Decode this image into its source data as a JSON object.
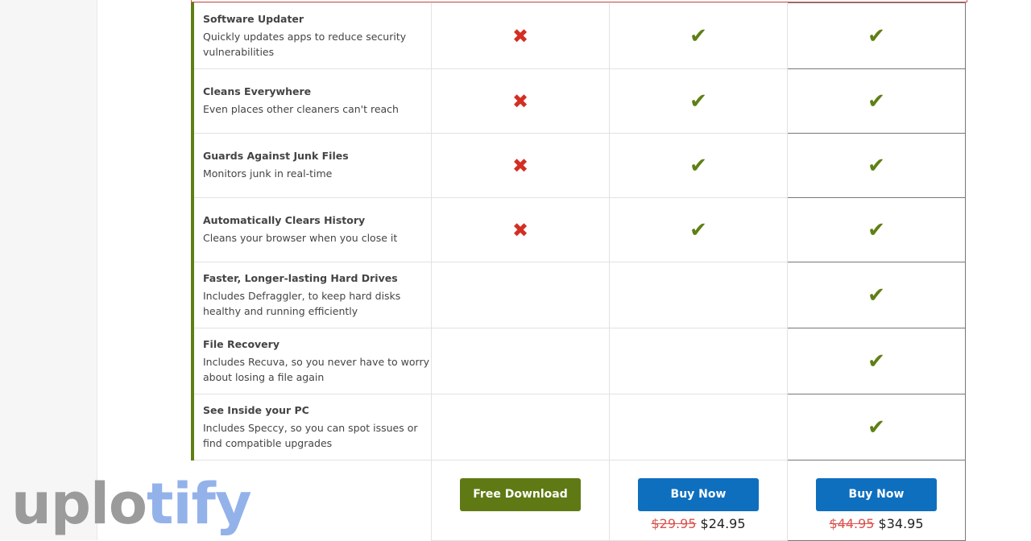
{
  "features": [
    {
      "title": "Software Updater",
      "desc": "Quickly updates apps to reduce security vulnerabilities",
      "plans": [
        false,
        true,
        true
      ]
    },
    {
      "title": "Cleans Everywhere",
      "desc": "Even places other cleaners can't reach",
      "plans": [
        false,
        true,
        true
      ]
    },
    {
      "title": "Guards Against Junk Files",
      "desc": "Monitors junk in real-time",
      "plans": [
        false,
        true,
        true
      ]
    },
    {
      "title": "Automatically Clears History",
      "desc": "Cleans your browser when you close it",
      "plans": [
        false,
        true,
        true
      ]
    },
    {
      "title": "Faster, Longer-lasting Hard Drives",
      "desc": "Includes Defraggler, to keep hard disks healthy and running efficiently",
      "plans": [
        null,
        null,
        true
      ]
    },
    {
      "title": "File Recovery",
      "desc": "Includes Recuva, so you never have to worry about losing a file again",
      "plans": [
        null,
        null,
        true
      ]
    },
    {
      "title": "See Inside your PC",
      "desc": "Includes Speccy, so you can spot issues or find compatible upgrades",
      "plans": [
        null,
        null,
        true
      ]
    }
  ],
  "actions": [
    {
      "label": "Free Download",
      "color": "#5f7a14"
    },
    {
      "label": "Buy Now",
      "color": "#0f6fbf",
      "old_price": "$29.95",
      "price": "$24.95"
    },
    {
      "label": "Buy Now",
      "color": "#0f6fbf",
      "old_price": "$44.95",
      "price": "$34.95"
    }
  ],
  "watermark": {
    "part1": "uplo",
    "part2": "tify"
  },
  "icons": {
    "yes": "check-icon",
    "no": "cross-icon"
  }
}
